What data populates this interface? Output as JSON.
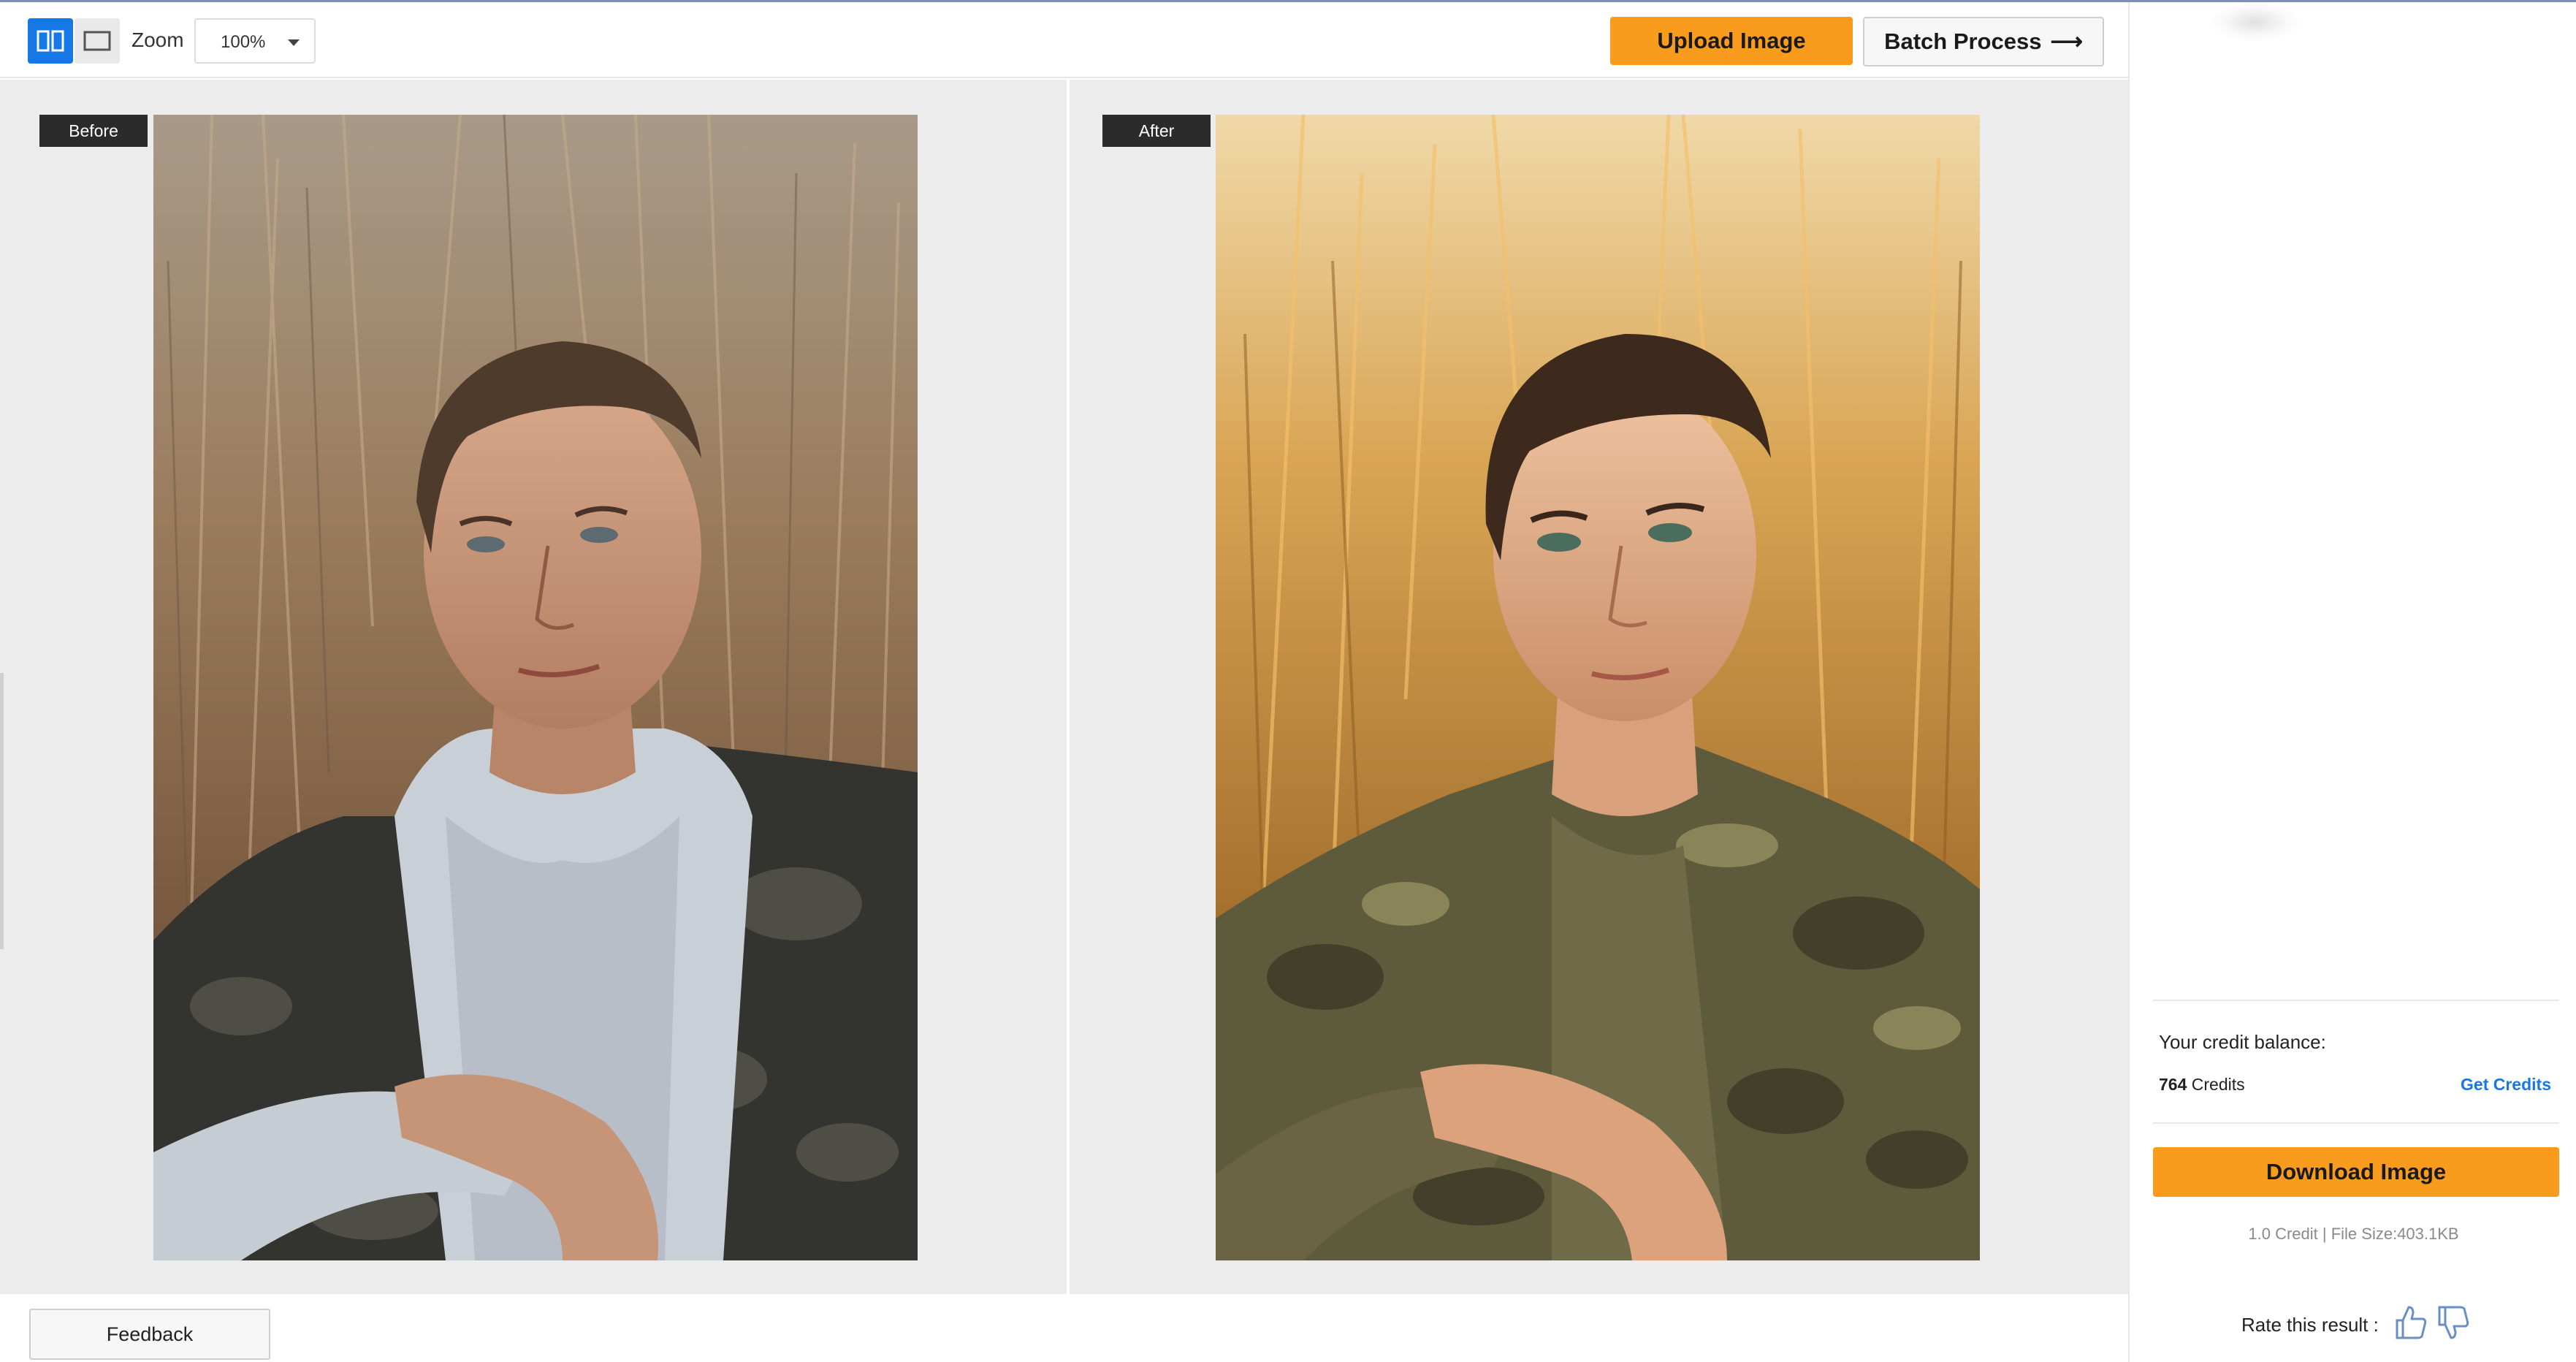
{
  "toolbar": {
    "zoom_label": "Zoom",
    "zoom_value": "100%",
    "upload_label": "Upload Image",
    "batch_label": "Batch Process",
    "batch_arrow": "⟶"
  },
  "panels": {
    "before_label": "Before",
    "after_label": "After"
  },
  "footer": {
    "feedback_label": "Feedback"
  },
  "sidebar": {
    "credit_balance_label": "Your credit balance:",
    "credit_count": "764",
    "credit_unit": " Credits",
    "get_credits_label": "Get Credits",
    "download_label": "Download Image",
    "file_info": "1.0 Credit | File Size:403.1KB",
    "rate_label": "Rate this result :"
  },
  "colors": {
    "accent_orange": "#f99b1c",
    "link_blue": "#1677e6",
    "tag_dark": "#2b2b2b"
  },
  "icons": [
    "split-view-icon",
    "single-view-icon",
    "chevron-down-icon",
    "arrow-right-icon",
    "thumbs-up-icon",
    "thumbs-down-icon"
  ]
}
